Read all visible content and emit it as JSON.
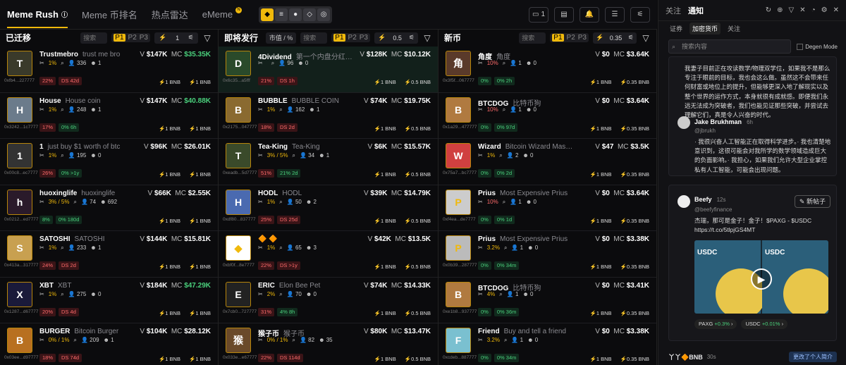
{
  "header": {
    "tabs": [
      {
        "label": "Meme Rush",
        "active": true
      },
      {
        "label": "Meme 币排名"
      },
      {
        "label": "热点雷达"
      },
      {
        "label": "eMeme"
      }
    ],
    "new_badge": "N",
    "chain_count": "1"
  },
  "columns": [
    {
      "title": "已迁移",
      "search": "搜索",
      "presets": [
        "P1",
        "P2",
        "P3"
      ],
      "slider_value": "1",
      "tokens": [
        {
          "letter": "T",
          "name": "Trustmebro",
          "sub": "trust me bro",
          "addr": "0xfb4...227777",
          "pct": "1%",
          "holders": "336",
          "snipers": "1",
          "p1": "22%",
          "p2": "DS 42d",
          "v": "$147K",
          "mc": "$35.35K",
          "mc_green": true,
          "bnb1": "1 BNB",
          "bnb2": "1 BNB",
          "bg": "#3a3a2a"
        },
        {
          "letter": "H",
          "name": "House",
          "sub": "House coin",
          "addr": "0x3242...1c7777",
          "pct": "1%",
          "holders": "248",
          "snipers": "1",
          "p1": "17%",
          "p2": "0% 6h",
          "p2g": true,
          "v": "$147K",
          "mc": "$40.88K",
          "mc_green": true,
          "bnb1": "1 BNB",
          "bnb2": "1 BNB",
          "bg": "#6b7b8b"
        },
        {
          "letter": "1",
          "name": "1",
          "sub": "just buy $1 worth of btc",
          "addr": "0x00c8...ec7777",
          "pct": "1%",
          "holders": "195",
          "snipers": "0",
          "p1": "26%",
          "p2": "0% >1y",
          "p2g": true,
          "v": "$96K",
          "mc": "$26.01K",
          "bnb1": "1 BNB",
          "bnb2": "1 BNB",
          "bg": "#333"
        },
        {
          "letter": "h",
          "name": "huoxinglife",
          "sub": "huoxinglife",
          "addr": "0x0212...ed7777",
          "pct": "3% / 5%",
          "holders": "74",
          "snipers": "692",
          "p1": "8%",
          "p2": "0% 180d",
          "p2g": true,
          "p1g": true,
          "v": "$66K",
          "mc": "$2.55K",
          "bnb1": "1 BNB",
          "bnb2": "1 BNB",
          "bg": "#2a1a2a"
        },
        {
          "letter": "S",
          "name": "SATOSHI",
          "sub": "SATOSHI",
          "addr": "0x413a...317777",
          "pct": "1%",
          "holders": "233",
          "snipers": "1",
          "p1": "24%",
          "p2": "DS 2d",
          "v": "$144K",
          "mc": "$15.81K",
          "bnb1": "1 BNB",
          "bnb2": "1 BNB",
          "bg": "#c8a050"
        },
        {
          "letter": "X",
          "name": "XBT",
          "sub": "XBT",
          "addr": "0x1287...d67777",
          "pct": "1%",
          "holders": "275",
          "snipers": "0",
          "p1": "20%",
          "p2": "DS 4d",
          "v": "$184K",
          "mc": "$47.29K",
          "mc_green": true,
          "bnb1": "1 BNB",
          "bnb2": "1 BNB",
          "bg": "#1a1a3a"
        },
        {
          "letter": "B",
          "name": "BURGER",
          "sub": "Bitcoin Burger",
          "addr": "0x03ee...d97777",
          "pct": "0% / 1%",
          "holders": "209",
          "snipers": "1",
          "p1": "18%",
          "p2": "DS 74d",
          "v": "$104K",
          "mc": "$28.12K",
          "bnb1": "1 BNB",
          "bnb2": "1 BNB",
          "bg": "#b87020"
        }
      ]
    },
    {
      "title": "即将发行",
      "tag": "市值 / %",
      "search": "搜索",
      "presets": [
        "P1",
        "P2",
        "P3"
      ],
      "slider_value": "0.5",
      "tokens": [
        {
          "letter": "D",
          "name": "4Dividend",
          "sub": "第一个内盘分红…",
          "addr": "0x6c35...a5fff",
          "pct": "",
          "holders": "96",
          "snipers": "0",
          "p1": "21%",
          "p2": "DS 1h",
          "v": "$128K",
          "mc": "$10.12K",
          "bnb1": "1 BNB",
          "bnb2": "0.5 BNB",
          "bg": "#2a4a2a",
          "hl": true
        },
        {
          "letter": "B",
          "name": "BUBBLE",
          "sub": "BUBBLE COIN",
          "addr": "0x2175...047777",
          "pct": "1%",
          "holders": "162",
          "snipers": "1",
          "p1": "18%",
          "p2": "DS 2d",
          "v": "$74K",
          "mc": "$19.75K",
          "bnb1": "1 BNB",
          "bnb2": "0.5 BNB",
          "bg": "#8a6a30"
        },
        {
          "letter": "T",
          "name": "Tea-King",
          "sub": "Tea-King",
          "addr": "0xeadb...5d7777",
          "pct": "3% / 5%",
          "holders": "34",
          "snipers": "1",
          "p1": "51%",
          "p2": "21% 2d",
          "p2g": true,
          "v": "$6K",
          "mc": "$15.57K",
          "bnb1": "1 BNB",
          "bnb2": "0.5 BNB",
          "bg": "#3a4a2a"
        },
        {
          "letter": "H",
          "name": "HODL",
          "sub": "HODL",
          "addr": "0xdf80...837777",
          "pct": "1%",
          "holders": "50",
          "snipers": "2",
          "p1": "25%",
          "p2": "DS 25d",
          "v": "$39K",
          "mc": "$14.79K",
          "bnb1": "1 BNB",
          "bnb2": "0.5 BNB",
          "bg": "#4a6ab0"
        },
        {
          "letter": "◆",
          "name": "🔶 🔶",
          "sub": "",
          "addr": "0xbf0f...8e7777",
          "pct": "1%",
          "holders": "65",
          "snipers": "3",
          "p1": "22%",
          "p2": "DS >1y",
          "v": "$42K",
          "mc": "$13.5K",
          "bnb1": "1 BNB",
          "bnb2": "0.5 BNB",
          "bg": "#fff"
        },
        {
          "letter": "E",
          "name": "ERIC",
          "sub": "Elon Bee Pet",
          "addr": "0x7cb0...727777",
          "pct": "2%",
          "holders": "70",
          "snipers": "0",
          "p1": "31%",
          "p2": "4% 8h",
          "p2g": true,
          "v": "$74K",
          "mc": "$14.33K",
          "bnb1": "1 BNB",
          "bnb2": "0.5 BNB",
          "bg": "#222"
        },
        {
          "letter": "猴",
          "name": "猴子币",
          "sub": "猴子币",
          "addr": "0x033e...e67777",
          "pct": "0% / 1%",
          "holders": "82",
          "snipers": "35",
          "p1": "22%",
          "p2": "DS 114d",
          "v": "$80K",
          "mc": "$13.47K",
          "bnb1": "1 BNB",
          "bnb2": "0.5 BNB",
          "bg": "#6a4a2a"
        }
      ]
    },
    {
      "title": "新币",
      "search": "搜索",
      "presets": [
        "P1",
        "P2",
        "P3"
      ],
      "slider_value": "0.35",
      "tokens": [
        {
          "letter": "角",
          "name": "角度",
          "sub": "角度",
          "addr": "0x3f5f...067777",
          "pct": "10%",
          "pct_red": true,
          "holders": "1",
          "snipers": "0",
          "p1": "0%",
          "p1g": true,
          "p2": "0% 2h",
          "p2g": true,
          "v": "$0",
          "mc": "$3.64K",
          "bnb1": "1 BNB",
          "bnb2": "0.35 BNB",
          "bg": "#5a3a2a"
        },
        {
          "letter": "B",
          "name": "BTCDOG",
          "sub": "比特币狗",
          "addr": "0x1a29...477777",
          "pct": "10%",
          "pct_red": true,
          "holders": "1",
          "snipers": "0",
          "p1": "0%",
          "p1g": true,
          "p2": "0% 97d",
          "p2g": true,
          "v": "$0",
          "mc": "$3.64K",
          "bnb1": "1 BNB",
          "bnb2": "0.35 BNB",
          "bg": "#b07a40"
        },
        {
          "letter": "W",
          "name": "Wizard",
          "sub": "Bitcoin Wizard Mas…",
          "addr": "0x75a7...bc7777",
          "pct": "1%",
          "holders": "2",
          "snipers": "0",
          "p1": "0%",
          "p1g": true,
          "p2": "0% 2d",
          "p2g": true,
          "v": "$47",
          "mc": "$3.5K",
          "bnb1": "1 BNB",
          "bnb2": "0.35 BNB",
          "bg": "#d04040"
        },
        {
          "letter": "P",
          "name": "Prius",
          "sub": "Most Expensive Prius",
          "addr": "0xf4ea...de7777",
          "pct": "10%",
          "pct_red": true,
          "holders": "1",
          "snipers": "0",
          "p1": "0%",
          "p1g": true,
          "p2": "0% 1d",
          "p2g": true,
          "v": "$0",
          "mc": "$3.64K",
          "bnb1": "1 BNB",
          "bnb2": "0.35 BNB",
          "bg": "#ccc"
        },
        {
          "letter": "P",
          "name": "Prius",
          "sub": "Most Expensive Prius",
          "addr": "0x0b39...287777",
          "pct": "3.2%",
          "holders": "1",
          "snipers": "0",
          "p1": "0%",
          "p1g": true,
          "p2": "0% 34m",
          "p2g": true,
          "v": "$0",
          "mc": "$3.38K",
          "bnb1": "1 BNB",
          "bnb2": "0.35 BNB",
          "bg": "#bbb"
        },
        {
          "letter": "B",
          "name": "BTCDOG",
          "sub": "比特币狗",
          "addr": "0xe1b8...937777",
          "pct": "4%",
          "holders": "1",
          "snipers": "0",
          "p1": "0%",
          "p1g": true,
          "p2": "0% 36m",
          "p2g": true,
          "v": "$0",
          "mc": "$3.41K",
          "bnb1": "1 BNB",
          "bnb2": "0.35 BNB",
          "bg": "#b07a40"
        },
        {
          "letter": "F",
          "name": "Friend",
          "sub": "Buy and tell a friend",
          "addr": "0xcdeb...887777",
          "pct": "3.2%",
          "holders": "1",
          "snipers": "0",
          "p1": "0%",
          "p1g": true,
          "p2": "0% 34m",
          "p2g": true,
          "v": "$0",
          "mc": "$3.38K",
          "bnb1": "1 BNB",
          "bnb2": "0.35 BNB",
          "bg": "#7ac0d0"
        }
      ]
    }
  ],
  "sidebar": {
    "tabs": [
      "关注",
      "通知"
    ],
    "subtabs": [
      "证券",
      "加密货币",
      "关注"
    ],
    "search_placeholder": "搜索内容",
    "degen": "Degen Mode",
    "post1": "我妻子目前正在攻读数学/物理双学位，如果我不是那么专注于眼前的目标，我也会这么做。虽然这不会带来任何财富或地位上的提升，但能够更深入地了解现实以及整个世界的运作方式，本身就很有成就感。即便我们永远无法成为突破者，我们也能见证那些突破，并尝试去理解它们，真是令人兴奋的时代。",
    "post2_user": "Jake Brukhman",
    "post2_time": "6h",
    "post2_handle": "@jbrukh",
    "post2_text": "· 我很兴奋人工智能正在取得科学进步。· 我也清楚地意识到，这很可能会对我所学的数学领域造成巨大的负面影响。· 我担心，如果我们允许大型企业掌控私有人工智能，可能会出现问题。",
    "beefy_user": "Beefy",
    "beefy_time": "12s",
    "beefy_handle": "@beefyfinance",
    "beefy_text": "杰瑞，那可是金子！金子！$PAXG - $USDC",
    "beefy_link": "https://t.co/5tlpjGS4MT",
    "new_post": "新帖子",
    "media_label": "USDC",
    "chip1": "PAXG",
    "chip1_val": "+0.3%",
    "chip2": "USDC",
    "chip2_val": "+0.01%",
    "bottom_user": "丫丫🔶BNB",
    "bottom_time": "30s",
    "bottom_action": "更改了个人简介"
  }
}
